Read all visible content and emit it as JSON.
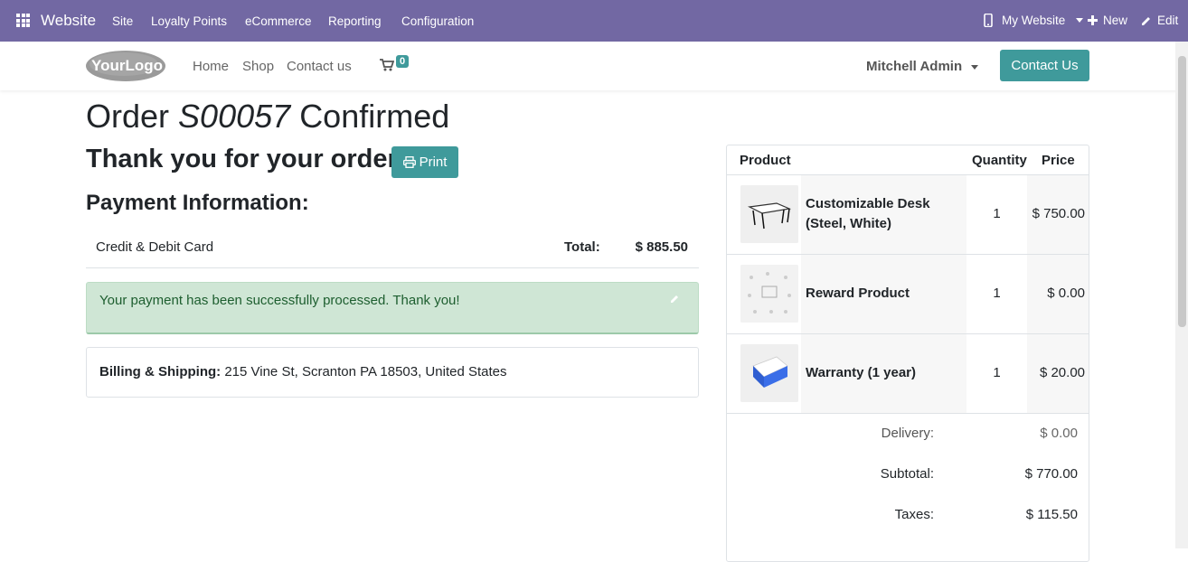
{
  "topbar": {
    "brand": "Website",
    "menu": [
      "Site",
      "Loyalty Points",
      "eCommerce",
      "Reporting",
      "Configuration"
    ],
    "website_switcher": "My Website",
    "new_label": "New",
    "edit_label": "Edit",
    "bg_color": "#7268a3"
  },
  "header": {
    "logo_text": "YourLogo",
    "nav": [
      "Home",
      "Shop",
      "Contact us"
    ],
    "cart_count": "0",
    "user": "Mitchell Admin",
    "contact_button": "Contact Us",
    "accent_color": "#3f9a9b"
  },
  "order": {
    "title_prefix": "Order",
    "order_number": "S00057",
    "title_suffix": "Confirmed",
    "thanks": "Thank you for your order.",
    "print_label": "Print"
  },
  "payment": {
    "heading": "Payment Information:",
    "method": "Credit & Debit Card",
    "total_label": "Total:",
    "total": "$ 885.50",
    "success_message": "Your payment has been successfully processed. Thank you!"
  },
  "address": {
    "label": "Billing & Shipping:",
    "value": "215 Vine St, Scranton PA 18503, United States"
  },
  "cart_table": {
    "headers": {
      "product": "Product",
      "quantity": "Quantity",
      "price": "Price"
    },
    "lines": [
      {
        "name_line1": "Customizable Desk",
        "name_line2": "(Steel, White)",
        "qty": "1",
        "price": "$ 750.00",
        "icon": "desk-image"
      },
      {
        "name_line1": "Reward Product",
        "name_line2": "",
        "qty": "1",
        "price": "$ 0.00",
        "icon": "reward-image"
      },
      {
        "name_line1": "Warranty (1 year)",
        "name_line2": "",
        "qty": "1",
        "price": "$ 20.00",
        "icon": "warranty-box-image"
      }
    ],
    "summary": [
      {
        "label": "Delivery:",
        "value": "$ 0.00"
      },
      {
        "label": "Subtotal:",
        "value": "$ 770.00"
      },
      {
        "label": "Taxes:",
        "value": "$ 115.50"
      }
    ]
  }
}
